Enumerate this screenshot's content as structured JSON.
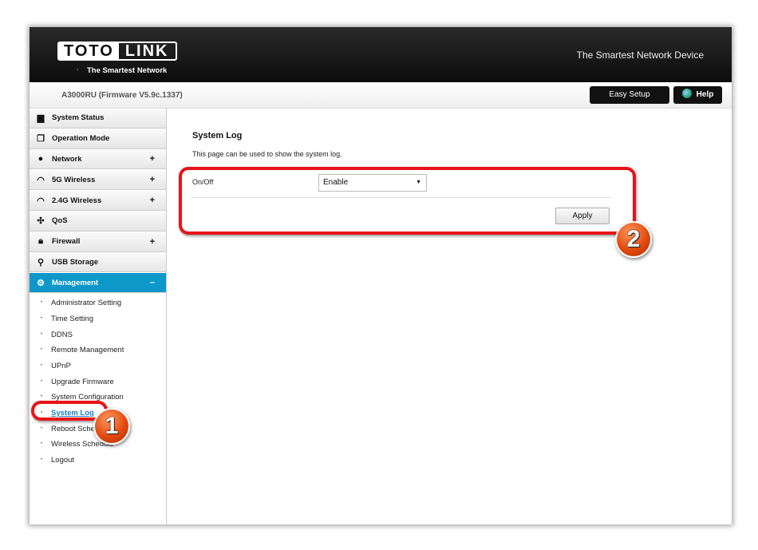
{
  "header": {
    "logo_left": "TOTO",
    "logo_right": "LINK",
    "logo_sub": "The Smartest Network Device",
    "tagline": "The Smartest Network Device"
  },
  "bar": {
    "model": "A3000RU (Firmware V5.9c.1337)",
    "easy_setup": "Easy Setup",
    "help": "Help"
  },
  "sidebar": {
    "items": [
      {
        "label": "System Status",
        "icon": "chat-icon",
        "expand": ""
      },
      {
        "label": "Operation Mode",
        "icon": "windows-icon",
        "expand": ""
      },
      {
        "label": "Network",
        "icon": "globe-icon",
        "expand": "+"
      },
      {
        "label": "5G Wireless",
        "icon": "wifi-icon",
        "expand": "+"
      },
      {
        "label": "2.4G Wireless",
        "icon": "wifi-icon",
        "expand": "+"
      },
      {
        "label": "QoS",
        "icon": "qos-icon",
        "expand": ""
      },
      {
        "label": "Firewall",
        "icon": "lock-icon",
        "expand": "+"
      },
      {
        "label": "USB Storage",
        "icon": "usb-icon",
        "expand": ""
      },
      {
        "label": "Management",
        "icon": "gear-icon",
        "expand": "–"
      }
    ],
    "subitems": [
      "Administrator Setting",
      "Time Setting",
      "DDNS",
      "Remote Management",
      "UPnP",
      "Upgrade Firmware",
      "System Configuration",
      "System Log",
      "Reboot Schedule",
      "Wireless Schedule",
      "Logout"
    ]
  },
  "main": {
    "title": "System Log",
    "description": "This page can be used to show the system log.",
    "onoff_label": "On/Off",
    "onoff_value": "Enable",
    "apply": "Apply"
  },
  "annotations": {
    "badge1": "1",
    "badge2": "2",
    "highlight_color": "#e8141a",
    "accent": "#0e98c9"
  }
}
